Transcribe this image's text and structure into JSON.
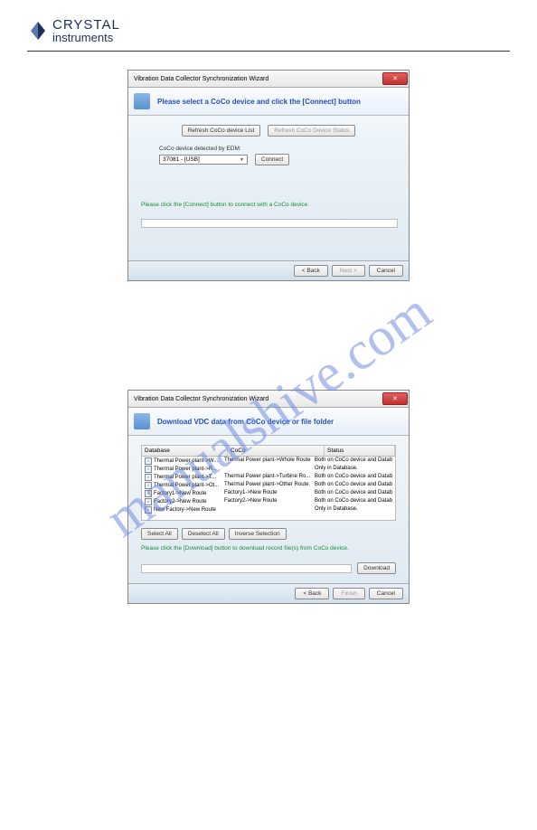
{
  "logo": {
    "top": "CRYSTAL",
    "bottom": "instruments"
  },
  "watermark": "manualshive.com",
  "dialog1": {
    "title": "Vibration Data Collector Synchronization Wizard",
    "header": "Please select a CoCo device and click the [Connect] button",
    "refresh_list": "Refresh CoCo device List",
    "refresh_status": "Refresh CoCo Device Status",
    "detected_label": "CoCo device detected by EDM:",
    "device": "37081 - [USB]",
    "connect": "Connect",
    "hint": "Please click the [Connect] button to connect with a CoCo device.",
    "back": "< Back",
    "next": "Next >",
    "cancel": "Cancel"
  },
  "dialog2": {
    "title": "Vibration Data Collector Synchronization Wizard",
    "header": "Download VDC data from CoCo device or file folder",
    "cols": {
      "database": "Database",
      "coco": "CoCo",
      "status": "Status"
    },
    "rows": [
      {
        "db": "Thermal Power plant->W...",
        "coco": "Thermal Power plant->Whole Route",
        "status": "Both on CoCo device and Database."
      },
      {
        "db": "Thermal Power plant->R...",
        "coco": "",
        "status": "Only in Database."
      },
      {
        "db": "Thermal Power plant->T...",
        "coco": "Thermal Power plant->Turbine Ro...",
        "status": "Both on CoCo device and Database."
      },
      {
        "db": "Thermal Power plant->Ot...",
        "coco": "Thermal Power plant->Other Route",
        "status": "Both on CoCo device and Database."
      },
      {
        "db": "Factory1->New Route",
        "coco": "Factory1->New Route",
        "status": "Both on CoCo device and Database."
      },
      {
        "db": "Factory2->New Route",
        "coco": "Factory2->New Route",
        "status": "Both on CoCo device and Database."
      },
      {
        "db": "New Factory->New Route",
        "coco": "",
        "status": "Only in Database."
      }
    ],
    "select_all": "Select All",
    "deselect_all": "Deselect All",
    "inverse": "Inverse Selection",
    "hint": "Please click the [Download] button to download record file(s) from CoCo device.",
    "download": "Download",
    "back": "< Back",
    "finish": "Finish",
    "cancel": "Cancel"
  }
}
